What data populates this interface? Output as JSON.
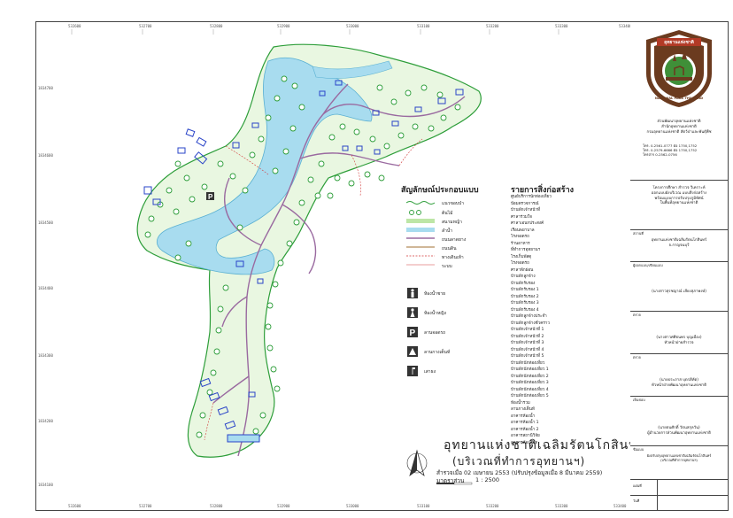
{
  "coords": {
    "top": [
      "532600",
      "532700",
      "532800",
      "532900",
      "533000",
      "533100",
      "533200",
      "533300",
      "533400"
    ],
    "bottom": [
      "532600",
      "532700",
      "532800",
      "532900",
      "533000",
      "533100",
      "533200",
      "533300",
      "533400"
    ],
    "left": [
      "1834700",
      "1834600",
      "1834500",
      "1834400",
      "1834300",
      "1834200",
      "1834100",
      "1834000"
    ]
  },
  "legend": {
    "title": "สัญลักษณ์ประกอบแบบ",
    "items": [
      {
        "label": "แนวขอบป่า"
      },
      {
        "label": "ต้นไม้"
      },
      {
        "label": "สนามหญ้า"
      },
      {
        "label": "ลำน้ำ"
      },
      {
        "label": "ถนนลาดยาง"
      },
      {
        "label": "ถนนดิน"
      },
      {
        "label": "ทางเดินเท้า"
      },
      {
        "label": "ระบบ"
      },
      {
        "label": "ห้องน้ำชาย"
      },
      {
        "label": "ห้องน้ำหญิง"
      },
      {
        "label": "ลานจอดรถ"
      },
      {
        "label": "ลานกางเต็นท์"
      },
      {
        "label": "เสาธง"
      }
    ]
  },
  "buildings": {
    "title": "รายการสิ่งก่อสร้าง",
    "items": [
      "ศูนย์บริการนักท่องเที่ยว",
      "ป้อมตรวจการณ์",
      "บ้านพักเจ้าหน้าที่",
      "ศาลาร่วมใจ",
      "ศาลาเอนกประสงค์",
      "เรือนพยาบาล",
      "โรงจอดรถ",
      "ร้านอาหาร",
      "ที่ทำการอุทยานฯ",
      "โรงเก็บพัสดุ",
      "โรงจอดรถ",
      "ศาลาพักผ่อน",
      "บ้านพักลูกจ้าง",
      "บ้านพักรับรอง",
      "บ้านพักรับรอง 1",
      "บ้านพักรับรอง 2",
      "บ้านพักรับรอง 3",
      "บ้านพักรับรอง 4",
      "บ้านพักลูกจ้างประจำ",
      "บ้านพักลูกจ้างชั่วคราว",
      "บ้านพักเจ้าหน้าที่ 1",
      "บ้านพักเจ้าหน้าที่ 2",
      "บ้านพักเจ้าหน้าที่ 3",
      "บ้านพักเจ้าหน้าที่ 4",
      "บ้านพักเจ้าหน้าที่ 5",
      "บ้านพักนักท่องเที่ยว",
      "บ้านพักนักท่องเที่ยว 1",
      "บ้านพักนักท่องเที่ยว 2",
      "บ้านพักนักท่องเที่ยว 3",
      "บ้านพักนักท่องเที่ยว 4",
      "บ้านพักนักท่องเที่ยว 5",
      "ห้องน้ำรวม",
      "ลานกางเต็นท์",
      "อาคารห้องน้ำ",
      "อาคารห้องน้ำ 1",
      "อาคารห้องน้ำ 2",
      "อาคารสถานีวิจัย",
      "อาคารห้องสมุด"
    ]
  },
  "park": {
    "title": "อุทยานแห่งชาติเฉลิมรัตนโกสินทร์",
    "subtitle": "(บริเวณที่ทำการอุทยานฯ)",
    "date_line": "สำรวจเมื่อ 02 เมษายน 2553 (ปรับปรุงข้อมูลเมื่อ 8 มีนาคม 2559)",
    "scale_label": "มาตราส่วน",
    "scale_value": "1 : 2500"
  },
  "logo": {
    "top_text": "อุทยานแห่งชาติ",
    "ring_text": "NATIONAL PARK THAILAND"
  },
  "panel": {
    "office_lines": [
      "ส่วนพัฒนาอุทยานแห่งชาติ",
      "สำนักอุทยานแห่งชาติ",
      "กรมอุทยานแห่งชาติ สัตว์ป่าและพันธุ์พืช"
    ],
    "tel_lines": [
      "โทร. 0-2561-0777 ต่อ 1750,1752",
      "โทร. 0-2579-6666 ต่อ 1750,1752",
      "โทรสาร 0-2562-0756"
    ],
    "project_lines": [
      "โครงการศึกษา สำรวจ วิเคราะห์",
      "ออกแบบผังบริเวณ แบบสิ่งก่อสร้าง",
      "พร้อมแบบการปรับปรุงภูมิทัศน์",
      "ในพื้นที่อุทยานแห่งชาติ"
    ],
    "place_label": "สถานที่",
    "place_lines": [
      "อุทยานแห่งชาติเฉลิมรัตนโกสินทร์",
      "จ.กาญจนบุรี"
    ],
    "designer_label": "ผู้ออกแบบ/เขียนแบบ",
    "designer_name": "(นางสาวสุรชญาณ์ เสียงสุภาพงษ์)",
    "checker1_label": "ตรวจ",
    "checker1_name": "(นางสาวศศิธนพร บุญเมือง)",
    "checker1_title": "หัวหน้าฝ่ายสำรวจ",
    "checker2_label": "ตรวจ",
    "checker2_name": "(นายประภาส บุตรสีทัต)",
    "checker2_title": "หัวหน้าฝ่ายพัฒนาอุทยานแห่งชาติ",
    "approver_label": "เห็นชอบ",
    "approver_name": "(นายธนศักดิ์ วัธนสกุลวัน)",
    "approver_title": "ผู้อำนวยการส่วนพัฒนาอุทยานแห่งชาติ",
    "drawing_label": "ชื่อแบบ",
    "drawing_lines": [
      "ผังปรับปรุงอุทยานแห่งชาติเฉลิมรัตนโกสินทร์",
      "(บริเวณที่ทำการอุทยานฯ)"
    ],
    "sheet_label": "แผ่นที่",
    "sheet_value": "",
    "date_label": "วันที่",
    "date_value": ""
  },
  "colors": {
    "water": "#a8dcef",
    "tree": "#2e9e3a",
    "lawn": "#bde6a6",
    "road": "#9a6aa0",
    "building": "#2a44c8",
    "path": "#d23a3a",
    "logo_brown": "#6b3b1f",
    "logo_green": "#3f8f38"
  }
}
